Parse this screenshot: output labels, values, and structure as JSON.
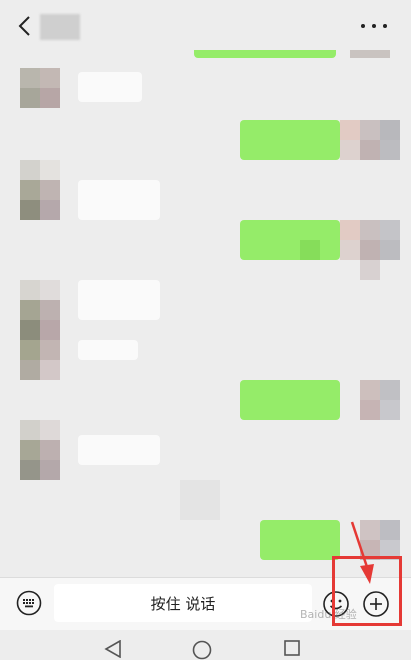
{
  "input_bar": {
    "voice_label": "按住 说话"
  },
  "watermark": {
    "text": "Baidu 经验"
  },
  "colors": {
    "background": "#ededed",
    "bubble_self": "#95ec69",
    "bubble_other": "#fafafa",
    "annotation": "#e53935"
  },
  "icons": {
    "back": "chevron-left-icon",
    "more": "more-dots-icon",
    "keyboard": "keyboard-icon",
    "emoji": "emoji-icon",
    "plus": "plus-circle-icon"
  }
}
